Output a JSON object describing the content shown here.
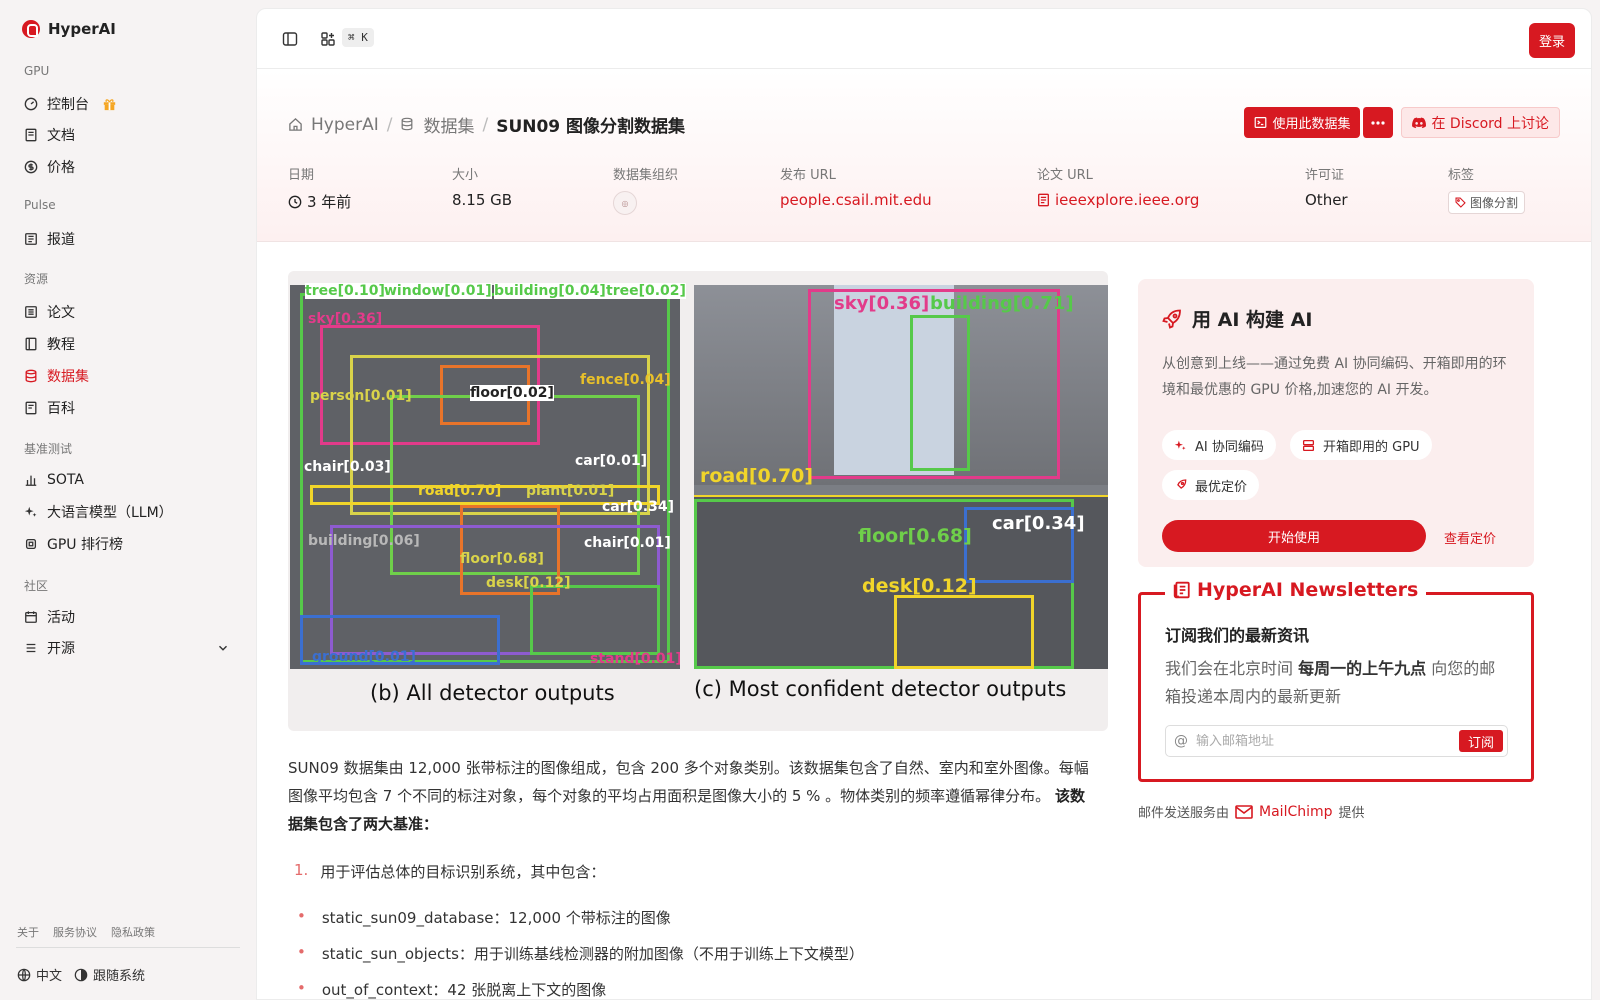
{
  "brand": {
    "name": "HyperAI",
    "accent": "#d71921"
  },
  "sidebar": {
    "sections": [
      {
        "label": "GPU"
      },
      {
        "label": "Pulse"
      },
      {
        "label": "资源"
      },
      {
        "label": "基准测试"
      },
      {
        "label": "社区"
      }
    ],
    "items": [
      {
        "label": "控制台",
        "icon": "gauge-icon"
      },
      {
        "label": "文档",
        "icon": "book-icon"
      },
      {
        "label": "价格",
        "icon": "dollar-icon"
      },
      {
        "label": "报道",
        "icon": "newspaper-icon"
      },
      {
        "label": "论文",
        "icon": "paper-icon"
      },
      {
        "label": "教程",
        "icon": "tutorial-icon"
      },
      {
        "label": "数据集",
        "icon": "database-icon"
      },
      {
        "label": "百科",
        "icon": "wiki-icon"
      },
      {
        "label": "SOTA",
        "icon": "bar-chart-icon"
      },
      {
        "label": "大语言模型（LLM）",
        "icon": "sparkle-icon"
      },
      {
        "label": "GPU 排行榜",
        "icon": "chip-icon"
      },
      {
        "label": "活动",
        "icon": "calendar-icon"
      },
      {
        "label": "开源",
        "icon": "list-icon"
      }
    ],
    "active_item": "数据集",
    "footer_links": [
      "关于",
      "服务协议",
      "隐私政策"
    ],
    "language": "中文",
    "tracking": "跟随系统"
  },
  "topbar": {
    "shortcut": "⌘ K",
    "login": "登录"
  },
  "breadcrumb": {
    "home": "HyperAI",
    "datasets": "数据集",
    "current": "SUN09 图像分割数据集"
  },
  "actions": {
    "use_dataset": "使用此数据集",
    "discord": "在 Discord 上讨论"
  },
  "meta": {
    "date": {
      "label": "日期",
      "value": "3 年前"
    },
    "size": {
      "label": "大小",
      "value": "8.15 GB"
    },
    "org": {
      "label": "数据集组织"
    },
    "publish_url": {
      "label": "发布 URL",
      "value": "people.csail.mit.edu"
    },
    "paper_url": {
      "label": "论文 URL",
      "value": "ieeexplore.ieee.org"
    },
    "license": {
      "label": "许可证",
      "value": "Other"
    },
    "tags": {
      "label": "标签",
      "value": "图像分割"
    }
  },
  "figure": {
    "caption_b": "(b) All detector outputs",
    "caption_c": "(c) Most confident detector outputs",
    "labels_b": [
      "tree[0.10]",
      "window[0.01]",
      "building[0.04]",
      "tree[0.02]",
      "sky[0.36]",
      "floor[0.02]",
      "fence[0.04]",
      "person[0.01]",
      "chair[0.03]",
      "car[0.01]",
      "road[0.70]",
      "plant[0.01]",
      "car[0.34]",
      "building[0.06]",
      "chair[0.01]",
      "floor[0.68]",
      "desk[0.12]",
      "ground[0.01]",
      "stand[0.01]"
    ],
    "labels_c": [
      "sky[0.36]",
      "building[0.71]",
      "road[0.70]",
      "car[0.34]",
      "floor[0.68]",
      "desk[0.12]"
    ]
  },
  "content": {
    "description": "SUN09 数据集由 12,000 张带标注的图像组成，包含 200 多个对象类别。该数据集包含了自然、室内和室外图像。每幅图像平均包含 7 个不同的标注对象，每个对象的平均占用面积是图像大小的 5 % 。物体类别的频率遵循幂律分布。",
    "description_bold": "该数据集包含了两大基准：",
    "ordered": [
      {
        "num": "1.",
        "text": "用于评估总体的目标识别系统，其中包含："
      }
    ],
    "bullets": [
      "static_sun09_database：12,000 个带标注的图像",
      "static_sun_objects：用于训练基线检测器的附加图像（不用于训练上下文模型）",
      "out_of_context：42 张脱离上下文的图像"
    ]
  },
  "ai_card": {
    "title": "用 AI 构建 AI",
    "desc": "从创意到上线——通过免费 AI 协同编码、开箱即用的环境和最优惠的 GPU 价格,加速您的 AI 开发。",
    "chips": [
      "AI 协同编码",
      "开箱即用的 GPU",
      "最优定价"
    ],
    "start": "开始使用",
    "pricing": "查看定价"
  },
  "newsletter": {
    "legend": "HyperAI Newsletters",
    "title": "订阅我们的最新资讯",
    "desc_pre": "我们会在北京时间 ",
    "desc_bold": "每周一的上午九点",
    "desc_post": " 向您的邮箱投递本周内的最新更新",
    "placeholder": "输入邮箱地址",
    "subscribe": "订阅",
    "note_pre": "邮件发送服务由",
    "note_brand": "MailChimp",
    "note_post": "提供"
  }
}
